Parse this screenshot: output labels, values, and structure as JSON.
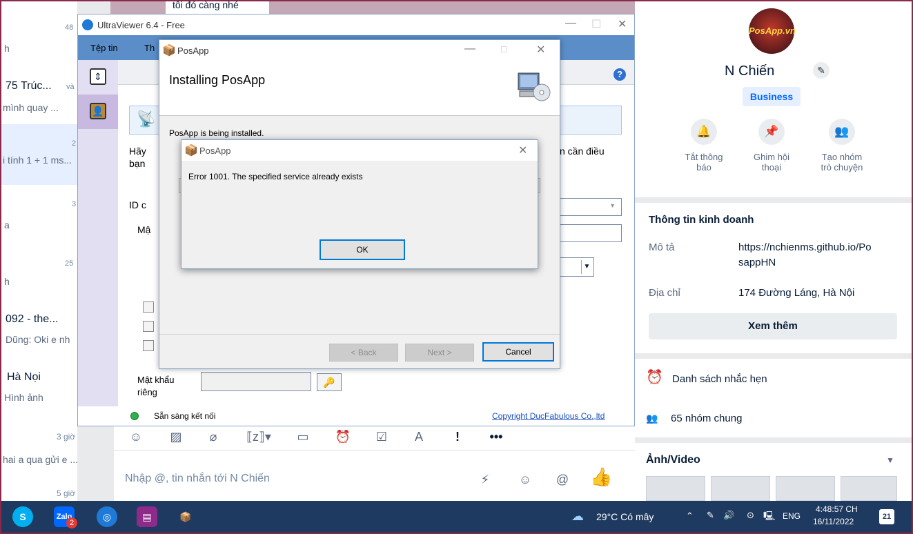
{
  "zalo_list": {
    "items": [
      {
        "time": "48",
        "name": "",
        "preview": "h"
      },
      {
        "time": "",
        "name": "75 Trúc...",
        "tag": "và",
        "preview": "mình quay ..."
      },
      {
        "time": "2",
        "name": "",
        "preview": "i tính 1 + 1 ms..."
      },
      {
        "time": "3",
        "name": "",
        "preview": "a"
      },
      {
        "time": "25",
        "name": "",
        "preview": "h"
      },
      {
        "time": "",
        "name": "092 - the...",
        "preview": "Dũng: Oki e nh"
      },
      {
        "time": "",
        "name": "Hà Nọi",
        "preview": "Hình ảnh"
      },
      {
        "time": "3 giờ",
        "name": "",
        "preview": "hai a qua gửi e ..."
      },
      {
        "time": "5 giờ",
        "name": "",
        "preview": ""
      }
    ]
  },
  "chat": {
    "top_bubble": "tôi đó càng nhé",
    "input_placeholder": "Nhập @, tin nhắn tới N Chiến"
  },
  "info_panel": {
    "avatar_text": "PosApp.vn",
    "name": "N Chiến",
    "badge": "Business",
    "actions": [
      {
        "icon": "bell-icon",
        "label1": "Tắt thông",
        "label2": "báo"
      },
      {
        "icon": "pin-icon",
        "label1": "Ghim hội",
        "label2": "thoại"
      },
      {
        "icon": "add-group-icon",
        "label1": "Tạo nhóm",
        "label2": "trò chuyện"
      }
    ],
    "business_title": "Thông tin kinh doanh",
    "desc_label": "Mô tả",
    "desc_value_1": "https://nchienms.github.io/Po",
    "desc_value_2": "sappHN",
    "addr_label": "Địa chỉ",
    "addr_value": "174 Đường Láng, Hà Nội",
    "see_more": "Xem thêm",
    "reminders": "Danh sách nhắc hẹn",
    "groups": "65 nhóm chung",
    "media": "Ảnh/Video"
  },
  "ultraviewer": {
    "title": "UltraViewer 6.4 - Free",
    "menu": [
      "Tệp tin",
      "Th"
    ],
    "partial_c": "C",
    "label_hay": "Hãy",
    "label_ban": "bạn",
    "label_can_dieu": "n cần điều",
    "label_id": "ID c",
    "label_mat": "Mậ",
    "label_private_pw_1": "Mật khẩu",
    "label_private_pw_2": "riêng",
    "status": "Sẵn sàng kết nối",
    "copyright": "Copyright DucFabulous Co.,ltd"
  },
  "posapp": {
    "title": "PosApp",
    "heading": "Installing PosApp",
    "message": "PosApp is being installed.",
    "btn_back": "< Back",
    "btn_next": "Next >",
    "btn_cancel": "Cancel"
  },
  "error_dialog": {
    "title": "PosApp",
    "message": "Error 1001. The specified service already exists",
    "ok": "OK"
  },
  "taskbar": {
    "zalo_badge": "2",
    "weather": "29°C Có mây",
    "lang": "ENG",
    "time": "4:48:57 CH",
    "date": "16/11/2022",
    "notif_count": "21"
  }
}
